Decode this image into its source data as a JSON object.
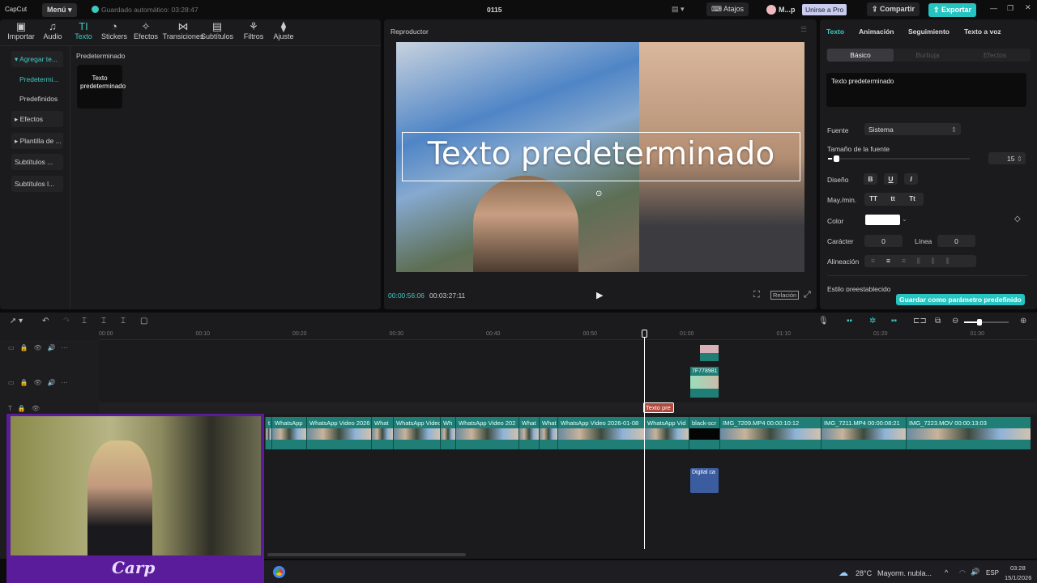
{
  "app": {
    "logo": "CapCut",
    "menu": "Menú",
    "autosave": "Guardado automático: 03:28:47",
    "project": "0115",
    "shortcuts": "Atajos",
    "user": "M...p",
    "pro": "Unirse a Pro",
    "share": "Compartir",
    "export": "Exportar",
    "accent": "#3fc9c0"
  },
  "toolbar": [
    {
      "icon": "import-icon",
      "label": "Importar"
    },
    {
      "icon": "audio-icon",
      "label": "Audio"
    },
    {
      "icon": "text-icon",
      "label": "Texto"
    },
    {
      "icon": "stickers-icon",
      "label": "Stickers"
    },
    {
      "icon": "effects-icon",
      "label": "Efectos"
    },
    {
      "icon": "transitions-icon",
      "label": "Transiciones"
    },
    {
      "icon": "subtitles-icon",
      "label": "Subtítulos"
    },
    {
      "icon": "filters-icon",
      "label": "Filtros"
    },
    {
      "icon": "adjust-icon",
      "label": "Ajuste"
    }
  ],
  "sidenav": [
    "▾ Agregar te...",
    "Predetermi...",
    "Predefinidos",
    "▸ Efectos",
    "▸ Plantilla de ...",
    "Subtítulos ...",
    "Subtítulos l..."
  ],
  "content": {
    "heading": "Predeterminado",
    "card": "Texto predeterminado"
  },
  "player": {
    "title": "Reproductor",
    "overlay_text": "Texto predeterminado",
    "current": "00:00:56:06",
    "total": "00:03:27:11",
    "ratio": "Relación"
  },
  "right": {
    "tabs": [
      "Texto",
      "Animación",
      "Seguimiento",
      "Texto a voz"
    ],
    "subtabs": [
      "Básico",
      "Burbuja",
      "Efectos"
    ],
    "text_value": "Texto predeterminado",
    "font_label": "Fuente",
    "font_value": "Sistema",
    "size_label": "Tamaño de la fuente",
    "size_value": "15",
    "size_fraction": 0.03,
    "design_label": "Diseño",
    "design": [
      "B",
      "U",
      "I"
    ],
    "case_label": "May./min.",
    "case": [
      "TT",
      "tt",
      "Tt"
    ],
    "color_label": "Color",
    "color_value": "#ffffff",
    "char_label": "Carácter",
    "char_value": "0",
    "line_label": "Línea",
    "line_value": "0",
    "align_label": "Alineación",
    "preset_label": "Estilo preestablecido",
    "save_preset": "Guardar como parámetro predefinido"
  },
  "timeline": {
    "ticks": [
      "00:00",
      "00:10",
      "00:20",
      "00:30",
      "00:40",
      "00:50",
      "01:00",
      "01:10",
      "01:20",
      "01:30"
    ],
    "sticker_clip": "7F778981",
    "text_clip": "Texto pre",
    "audio_clip": "Digital ca",
    "clips": [
      "t",
      "WhatsApp",
      "WhatsApp Video 2026",
      "What",
      "WhatsApp Video",
      "Wh",
      "WhatsApp Video 202",
      "What",
      "What",
      "WhatsApp Video 2026-01-08",
      "WhatsApp Vid",
      "black-scr",
      "IMG_7209.MP4  00:00:10:12",
      "IMG_7211.MP4  00:00:08:21",
      "IMG_7223.MOV  00:00:13:03"
    ]
  },
  "webcam": {
    "logo": "Carp"
  },
  "taskbar": {
    "temp": "28°C",
    "weather": "Mayorm. nubla...",
    "lang": "ESP",
    "time": "03:28",
    "date": "15/1/2026"
  }
}
